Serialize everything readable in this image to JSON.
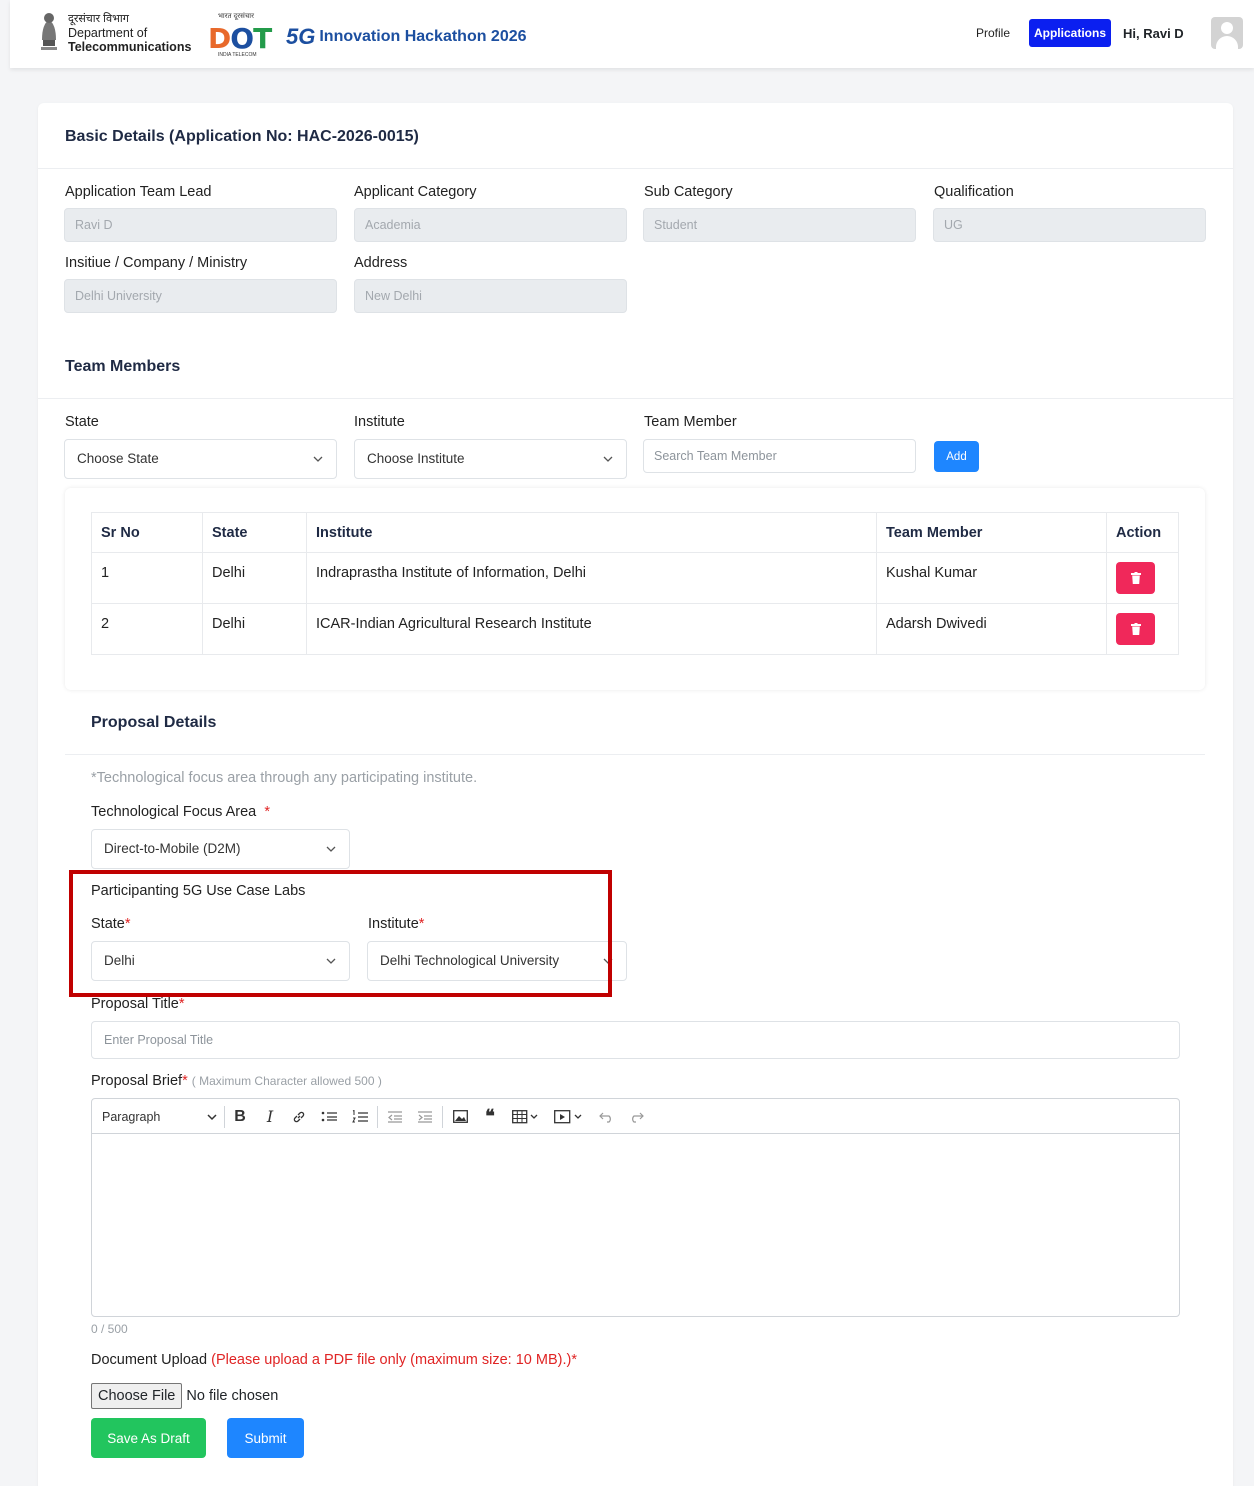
{
  "header": {
    "dept_hindi": "दूरसंचार विभाग",
    "dept_line1": "Department of",
    "dept_line2": "Telecommunications",
    "brand_top": "भारत दूरसंचार",
    "brand_sub": "INDIA TELECOM",
    "hack_prefix": "5G",
    "hack_title": "Innovation Hackathon 2026",
    "nav_profile": "Profile",
    "nav_applications": "Applications",
    "greeting": "Hi, Ravi D"
  },
  "basic": {
    "title": "Basic Details (Application No: HAC-2026-0015)",
    "fields": [
      {
        "label": "Application Team Lead",
        "value": "Ravi D"
      },
      {
        "label": "Applicant Category",
        "value": "Academia"
      },
      {
        "label": "Sub Category",
        "value": "Student"
      },
      {
        "label": "Qualification",
        "value": "UG"
      },
      {
        "label": "Insitiue / Company / Ministry",
        "value": "Delhi University"
      },
      {
        "label": "Address",
        "value": "New Delhi"
      }
    ]
  },
  "team": {
    "title": "Team Members",
    "state_label": "State",
    "state_placeholder": "Choose State",
    "institute_label": "Institute",
    "institute_placeholder": "Choose Institute",
    "member_label": "Team Member",
    "member_placeholder": "Search Team Member",
    "add_label": "Add",
    "columns": [
      "Sr No",
      "State",
      "Institute",
      "Team Member",
      "Action"
    ],
    "rows": [
      {
        "sr": "1",
        "state": "Delhi",
        "institute": "Indraprastha Institute of Information, Delhi",
        "member": "Kushal Kumar"
      },
      {
        "sr": "2",
        "state": "Delhi",
        "institute": "ICAR-Indian Agricultural Research Institute",
        "member": "Adarsh Dwivedi"
      }
    ]
  },
  "proposal": {
    "title": "Proposal Details",
    "note": "*Technological focus area through any participating institute.",
    "focus_label": "Technological Focus Area",
    "focus_value": "Direct-to-Mobile (D2M)",
    "labs_label": "Participanting 5G Use Case Labs",
    "state_label": "State",
    "state_value": "Delhi",
    "institute_label": "Institute",
    "institute_value": "Delhi Technological University",
    "title_label": "Proposal Title",
    "title_placeholder": "Enter Proposal Title",
    "brief_label": "Proposal Brief",
    "brief_hint": "( Maximum Character allowed 500 )",
    "paragraph_option": "Paragraph",
    "char_count": "0 / 500",
    "upload_label": "Document Upload",
    "upload_hint": "(Please upload a PDF file only (maximum size: 10 MB).)",
    "choose_file": "Choose File",
    "no_file": "No file chosen",
    "save_draft": "Save As Draft",
    "submit": "Submit"
  },
  "required_mark": "*",
  "colors": {
    "primary": "#1e86ff",
    "nav_active": "#0b1ff0",
    "danger": "#f0285a",
    "success": "#22c55e",
    "highlight": "#c00000"
  }
}
